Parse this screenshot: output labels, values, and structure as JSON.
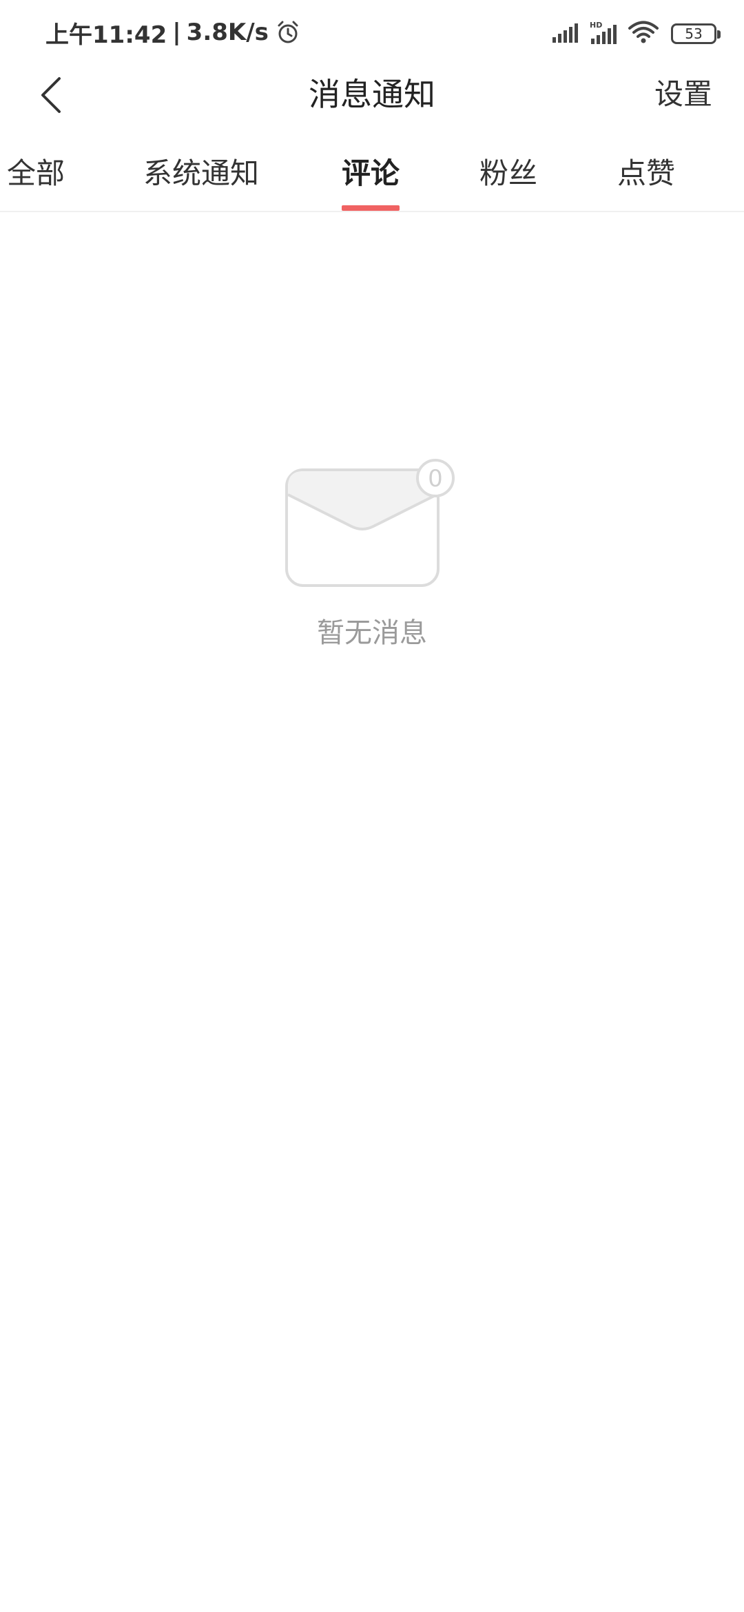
{
  "status_bar": {
    "time": "上午11:42",
    "separator": "|",
    "net_speed": "3.8K/s",
    "battery_level": "53"
  },
  "nav": {
    "title": "消息通知",
    "settings_label": "设置"
  },
  "tabs": [
    {
      "label": "全部",
      "active": false
    },
    {
      "label": "系统通知",
      "active": false
    },
    {
      "label": "评论",
      "active": true
    },
    {
      "label": "粉丝",
      "active": false
    },
    {
      "label": "点赞",
      "active": false
    }
  ],
  "empty_state": {
    "badge_count": "0",
    "message": "暂无消息"
  },
  "colors": {
    "accent": "#f06262",
    "muted_text": "#9a9a9a",
    "icon_stroke": "#dcdcdc"
  }
}
